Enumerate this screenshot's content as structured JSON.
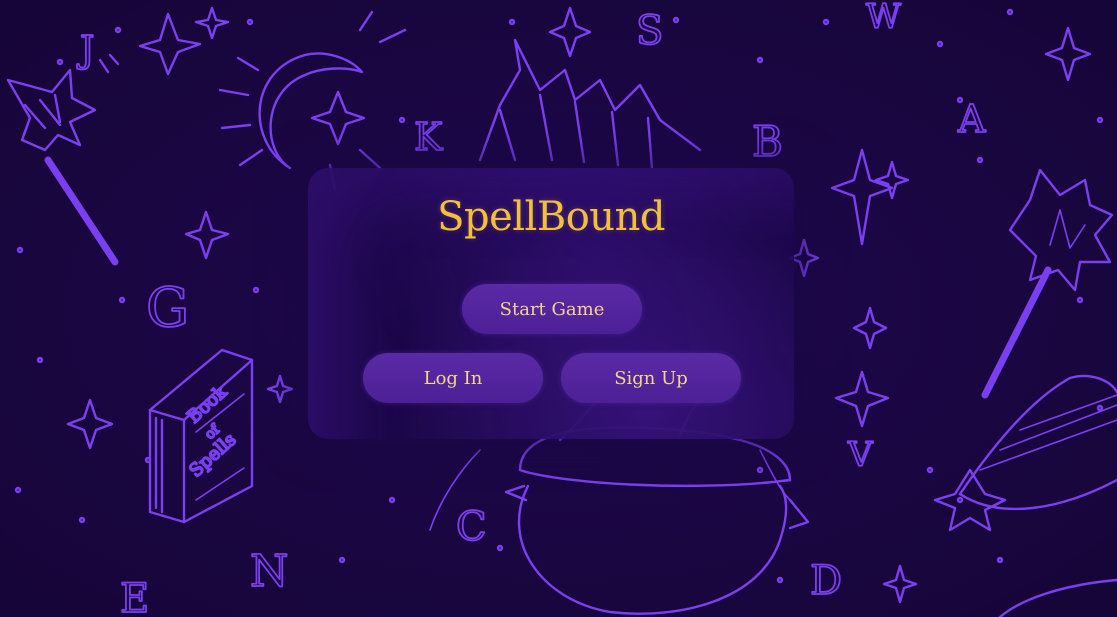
{
  "app": {
    "title_part1": "Spell",
    "title_part2": "Bound"
  },
  "menu": {
    "start_label": "Start Game",
    "login_label": "Log In",
    "signup_label": "Sign Up"
  },
  "background": {
    "book_text_line1": "Book",
    "book_text_line2": "of",
    "book_text_line3": "Spells",
    "letters": [
      "J",
      "S",
      "W",
      "K",
      "B",
      "A",
      "G",
      "V",
      "C",
      "N",
      "D",
      "E"
    ]
  },
  "colors": {
    "background": "#1c0745",
    "doodle_stroke": "#7a3ff0",
    "panel": "#1c0848",
    "title": "#f2c13c",
    "button": "#5a2aa6",
    "button_text": "#f4d58a"
  },
  "icons": [
    "star-icon",
    "moon-icon",
    "wand-icon",
    "book-icon",
    "cauldron-icon",
    "witch-hat-icon",
    "broom-icon"
  ]
}
